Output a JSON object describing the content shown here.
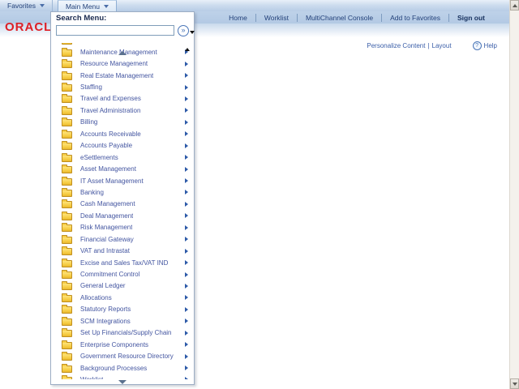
{
  "header": {
    "logo_text": "ORACLE",
    "tabs": [
      {
        "label": "Favorites",
        "active": false
      },
      {
        "label": "Main Menu",
        "active": true
      }
    ],
    "nav_links": [
      {
        "label": "Home",
        "bold": false
      },
      {
        "label": "Worklist",
        "bold": false
      },
      {
        "label": "MultiChannel Console",
        "bold": false
      },
      {
        "label": "Add to Favorites",
        "bold": false
      },
      {
        "label": "Sign out",
        "bold": true
      }
    ],
    "personalize_links": [
      "Personalize Content",
      "Layout"
    ],
    "personalize_separator": "|",
    "help_label": "Help"
  },
  "menu_panel": {
    "search_label": "Search Menu:",
    "search_value": "",
    "items": [
      "Maintenance Management",
      "Resource Management",
      "Real Estate Management",
      "Staffing",
      "Travel and Expenses",
      "Travel Administration",
      "Billing",
      "Accounts Receivable",
      "Accounts Payable",
      "eSettlements",
      "Asset Management",
      "IT Asset Management",
      "Banking",
      "Cash Management",
      "Deal Management",
      "Risk Management",
      "Financial Gateway",
      "VAT and Intrastat",
      "Excise and Sales Tax/VAT IND",
      "Commitment Control",
      "General Ledger",
      "Allocations",
      "Statutory Reports",
      "SCM Integrations",
      "Set Up Financials/Supply Chain",
      "Enterprise Components",
      "Government Resource Directory",
      "Background Processes"
    ],
    "clipped_top_item": "",
    "clipped_bottom_item": "Worklist"
  },
  "icons": {
    "search_go_glyph": "»",
    "help_glyph": "?"
  },
  "colors": {
    "oracle_red": "#dd1f26",
    "menu_item_blue": "#4355a0",
    "folder_yellow": "#f7ce46",
    "header_band_blue": "#b9cde7",
    "link_blue": "#24427a"
  }
}
